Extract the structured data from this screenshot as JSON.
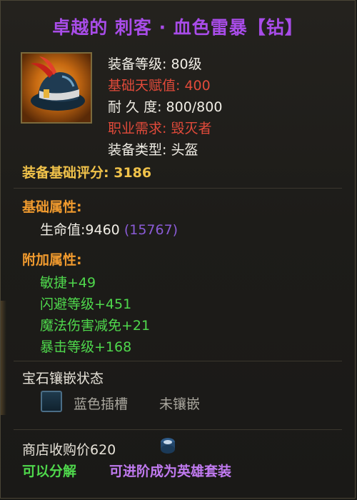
{
  "item": {
    "title": "卓越的 刺客 · 血色雷暴【钻】",
    "icon": "assassin-helmet-icon"
  },
  "stats": {
    "level": "装备等级: 80级",
    "talent": "基础天赋值: 400",
    "durability": "耐 久 度: 800/800",
    "class_req": "职业需求: 毁灭者",
    "type": "装备类型: 头盔"
  },
  "score": {
    "label": "装备基础评分: ",
    "value": "3186"
  },
  "base_attrs": {
    "heading": "基础属性:",
    "hp_label": "生命值:9460",
    "hp_extra": "(15767)"
  },
  "extra_attrs": {
    "heading": "附加属性:",
    "items": [
      "敏捷+49",
      "闪避等级+451",
      "魔法伤害减免+21",
      "暴击等级+168"
    ]
  },
  "gems": {
    "heading": "宝石镶嵌状态",
    "slot_label": "蓝色插槽",
    "slot_status": "未镶嵌"
  },
  "footer": {
    "shop_price": "商店收购价620",
    "coin_icon": "coin-icon",
    "decompose": "可以分解",
    "upgrade": "可进阶成为英雄套装"
  },
  "colors": {
    "title": "#a84ce8",
    "red": "#e14a3a",
    "gold": "#f0c24a",
    "orange": "#f09a2e",
    "green": "#4fd84c",
    "purple": "#8a5bd6"
  }
}
